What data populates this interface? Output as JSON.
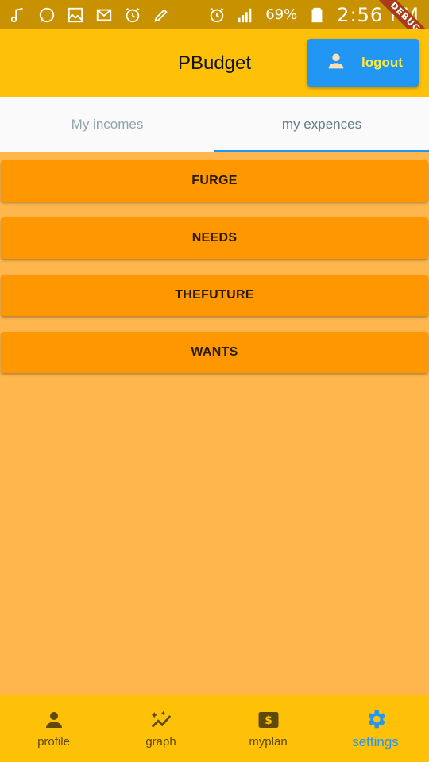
{
  "status_bar": {
    "battery": "69%",
    "time": "2:56 PM",
    "debug_banner": "DEBUG",
    "icons": [
      "music-note-icon",
      "whatsapp-icon",
      "image-icon",
      "mail-icon",
      "alarm-icon",
      "pen-icon",
      "alarm-icon",
      "signal-icon",
      "battery-icon"
    ]
  },
  "app_bar": {
    "title": "PBudget",
    "logout_label": "logout"
  },
  "tabs": [
    {
      "label": "My incomes"
    },
    {
      "label": "my expences"
    }
  ],
  "categories": [
    "FURGE",
    "NEEDS",
    "THEFUTURE",
    "WANTS"
  ],
  "bottom_nav": [
    {
      "label": "profile",
      "icon": "person-icon"
    },
    {
      "label": "graph",
      "icon": "auto-graph-icon"
    },
    {
      "label": "myplan",
      "icon": "money-icon"
    },
    {
      "label": "settings",
      "icon": "gear-icon"
    }
  ],
  "colors": {
    "status_bar": "#C79100",
    "app_bar": "#FFC107",
    "body": "#FFB74D",
    "category_button": "#FF9800",
    "accent": "#2196F3"
  }
}
